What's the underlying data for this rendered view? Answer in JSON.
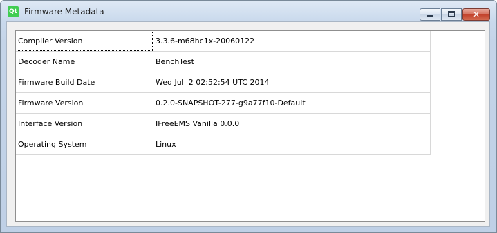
{
  "window": {
    "app_icon_text": "Qt",
    "title": "Firmware Metadata",
    "controls": {
      "minimize_icon": "minimize-icon",
      "maximize_icon": "maximize-icon",
      "close_glyph": "✕"
    }
  },
  "table": {
    "rows": [
      {
        "key": "Compiler Version",
        "value": "3.3.6-m68hc1x-20060122"
      },
      {
        "key": "Decoder Name",
        "value": "BenchTest"
      },
      {
        "key": "Firmware Build Date",
        "value": "Wed Jul  2 02:52:54 UTC 2014"
      },
      {
        "key": "Firmware Version",
        "value": "0.2.0-SNAPSHOT-277-g9a77f10-Default"
      },
      {
        "key": "Interface Version",
        "value": "IFreeEMS Vanilla 0.0.0"
      },
      {
        "key": "Operating System",
        "value": "Linux"
      }
    ]
  }
}
